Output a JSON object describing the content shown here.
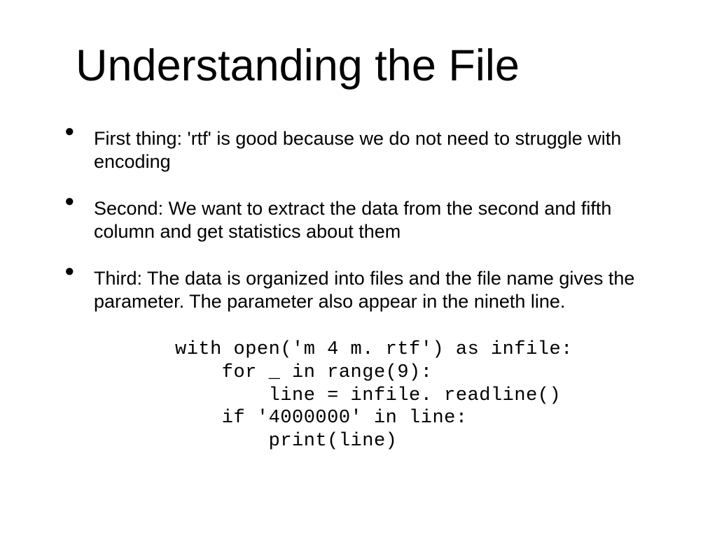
{
  "title": "Understanding the File",
  "bullets": [
    "First thing: 'rtf' is good because we do not need to struggle with encoding",
    "Second: We want to extract the data from the second and fifth column and get statistics about them",
    "Third: The data is organized into files and the file name gives the parameter. The parameter also appear in the nineth line."
  ],
  "code": "with open('m 4 m. rtf') as infile:\n    for _ in range(9):\n        line = infile. readline()\n    if '4000000' in line:\n        print(line)"
}
